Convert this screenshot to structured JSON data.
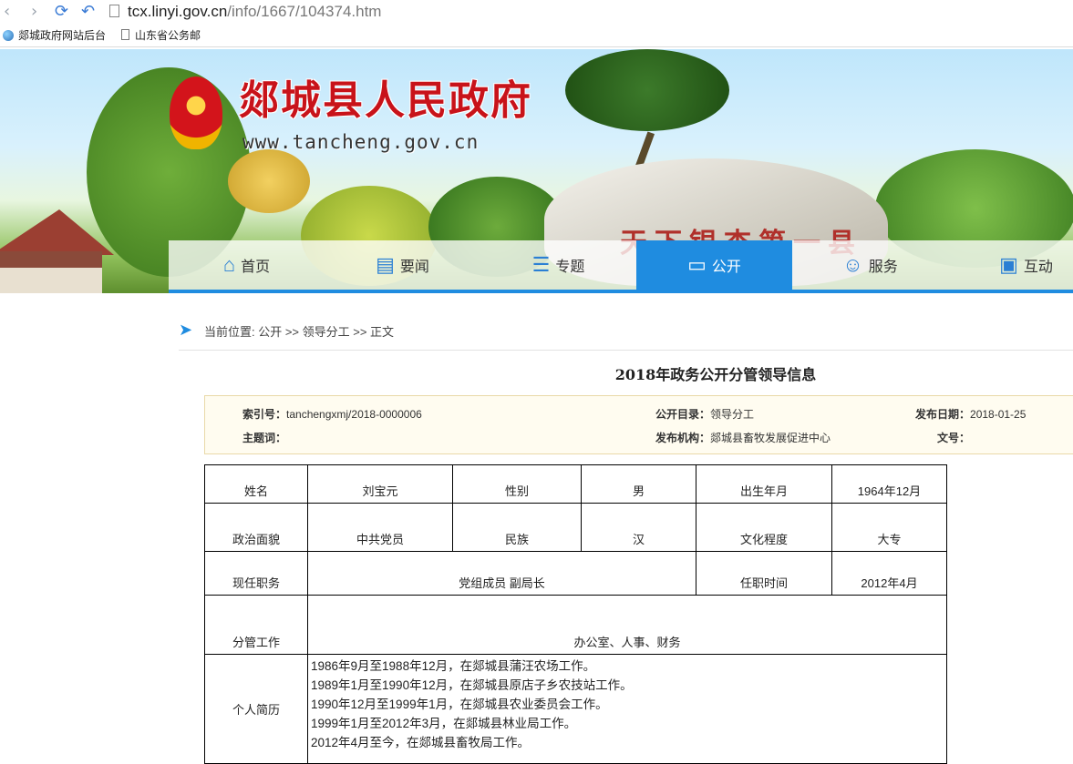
{
  "browser": {
    "url_host": "tcx.linyi.gov.cn",
    "url_path": "/info/1667/104374.htm",
    "bookmarks": [
      "郯城政府网站后台",
      "山东省公务邮"
    ]
  },
  "banner": {
    "site_title": "郯城县人民政府",
    "site_url": "www.tancheng.gov.cn",
    "rock_inscription": "天下银杏第一县"
  },
  "nav": [
    {
      "label": "首页",
      "icon": "home-icon"
    },
    {
      "label": "要闻",
      "icon": "news-icon"
    },
    {
      "label": "专题",
      "icon": "list-icon"
    },
    {
      "label": "公开",
      "icon": "folder-icon",
      "active": true
    },
    {
      "label": "服务",
      "icon": "user-icon"
    },
    {
      "label": "互动",
      "icon": "chat-icon"
    }
  ],
  "breadcrumb": {
    "text": "当前位置: 公开 >> 领导分工 >> 正文"
  },
  "article": {
    "title": "2018年政务公开分管领导信息"
  },
  "meta": {
    "index_label": "索引号：",
    "index_value": "tanchengxmj/2018-0000006",
    "catalog_label": "公开目录：",
    "catalog_value": "领导分工",
    "date_label": "发布日期：",
    "date_value": "2018-01-25",
    "keywords_label": "主题词：",
    "keywords_value": "",
    "org_label": "发布机构：",
    "org_value": "郯城县畜牧发展促进中心",
    "docno_label": "文号：",
    "docno_value": ""
  },
  "profile": {
    "name_label": "姓名",
    "name": "刘宝元",
    "gender_label": "性别",
    "gender": "男",
    "birth_label": "出生年月",
    "birth": "1964年12月",
    "party_label": "政治面貌",
    "party": "中共党员",
    "ethnic_label": "民族",
    "ethnic": "汉",
    "edu_label": "文化程度",
    "edu": "大专",
    "position_label": "现任职务",
    "position": "党组成员 副局长",
    "since_label": "任职时间",
    "since": "2012年4月",
    "duty_label": "分管工作",
    "duty": "办公室、人事、财务",
    "resume_label": "个人简历",
    "resume": [
      "1986年9月至1988年12月，在郯城县蒲汪农场工作。",
      "1989年1月至1990年12月，在郯城县原店子乡农技站工作。",
      "1990年12月至1999年1月，在郯城县农业委员会工作。",
      "1999年1月至2012年3月，在郯城县林业局工作。",
      "2012年4月至今，在郯城县畜牧局工作。"
    ]
  }
}
